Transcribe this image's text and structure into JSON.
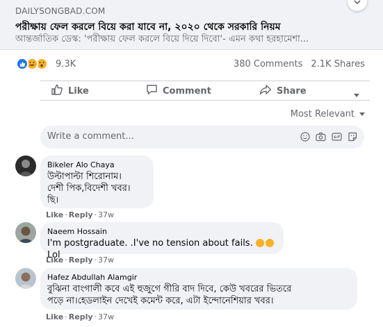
{
  "link_preview": {
    "domain": "DAILYSONGBAD.COM",
    "title": "পরীক্ষায় ফেল করলে বিয়ে করা যাবে না, ২০২০ থেকে সরকারি নিয়ম",
    "description": "আন্তর্জাতিক ডেস্ক: 'পরীক্ষায় ফেল করলে বিয়ে দিয়ে দিবো'- এমন কথা হরহামেশা..."
  },
  "stats": {
    "reaction_count": "9.3K",
    "comments": "380 Comments",
    "shares": "2.1K Shares"
  },
  "actions": {
    "like": "Like",
    "comment": "Comment",
    "share": "Share"
  },
  "sort": {
    "label": "Most Relevant"
  },
  "composer": {
    "placeholder": "Write a comment..."
  },
  "comments": [
    {
      "author": "Bikeler Alo Chaya",
      "text": "উল্টাপাল্টা শিরোনাম।\nদেশী পিক,বিদেশী খবর।\nছি।",
      "like": "Like",
      "reply": "Reply",
      "time": "37w"
    },
    {
      "author": "Naeem Hossain",
      "text": "I'm postgraduate. .I've no tension about fails.",
      "text_suffix": "Lol",
      "like": "Like",
      "reply": "Reply",
      "time": "37w"
    },
    {
      "author": "Hafez Abdullah Alamgir",
      "text": "বুঝিনা বাংগালী কবে এই হুজুগে গীরি বাদ দিবে, কেউ খবরের ভিতরে\nপড়ে না।হেডলাইন দেখেই কমেন্ট করে, এটা ইন্দোনেশিয়ার খবর।",
      "like": "Like",
      "reply": "Reply",
      "time": "37w"
    }
  ],
  "colors": {
    "accent": "#1877f2",
    "secondary_text": "#65676b",
    "bubble_bg": "#f0f2f5"
  }
}
